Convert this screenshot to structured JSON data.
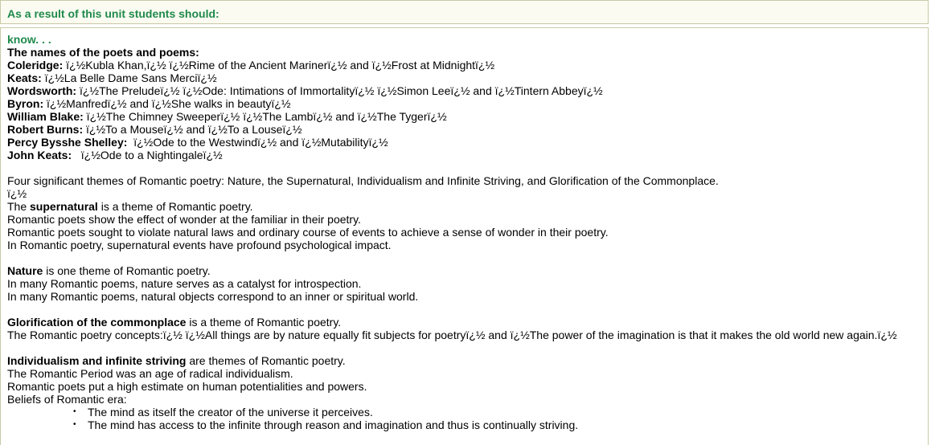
{
  "header": {
    "title": "As a result of this unit students should:"
  },
  "know_label": "know. . .",
  "names_heading": "The names of the poets and poems:",
  "poets": [
    {
      "name": "Coleridge:",
      "works": " ï¿½Kubla Khan,ï¿½ ï¿½Rime of the Ancient Marinerï¿½ and ï¿½Frost at Midnightï¿½"
    },
    {
      "name": "Keats:",
      "works": " ï¿½La Belle Dame Sans Merciï¿½"
    },
    {
      "name": "Wordsworth:",
      "works": " ï¿½The Preludeï¿½ ï¿½Ode: Intimations of Immortalityï¿½ ï¿½Simon Leeï¿½ and ï¿½Tintern Abbeyï¿½"
    },
    {
      "name": "Byron:",
      "works": " ï¿½Manfredï¿½ and ï¿½She walks in beautyï¿½"
    },
    {
      "name": "William Blake:",
      "works": " ï¿½The Chimney Sweeperï¿½ ï¿½The Lambï¿½ and ï¿½The Tygerï¿½"
    },
    {
      "name": "Robert Burns:",
      "works": " ï¿½To a Mouseï¿½ and ï¿½To a Louseï¿½"
    },
    {
      "name": "Percy Bysshe Shelley:",
      "works": "  ï¿½Ode to the Westwindï¿½ and ï¿½Mutabilityï¿½"
    },
    {
      "name": "John Keats:",
      "works": "   ï¿½Ode to a Nightingaleï¿½"
    }
  ],
  "themes_intro": "Four significant themes of Romantic poetry: Nature, the Supernatural, Individualism and Infinite Striving, and Glorification of the Commonplace.",
  "stray": "ï¿½",
  "supernatural": {
    "pre": "The ",
    "bold": "supernatural",
    "post": " is a theme of Romantic poetry.",
    "lines": [
      "Romantic poets show the effect of wonder at the familiar in their poetry.",
      "Romantic poets sought to violate natural laws and ordinary course of events to achieve a sense of wonder in their poetry.",
      "In Romantic poetry, supernatural events have profound psychological impact."
    ]
  },
  "nature": {
    "bold": "Nature",
    "post": " is one theme of Romantic poetry.",
    "lines": [
      "In many Romantic poems, nature serves as a catalyst for introspection.",
      "In many Romantic poems, natural objects correspond to an inner or spiritual world."
    ]
  },
  "commonplace": {
    "bold": "Glorification of the commonplace",
    "post": " is a theme of Romantic poetry.",
    "lines": [
      "The Romantic poetry concepts:ï¿½ ï¿½All things are by nature equally fit subjects for poetryï¿½ and ï¿½The power of the imagination is that it makes the old world new again.ï¿½"
    ]
  },
  "individualism": {
    "bold": "Individualism and infinite striving",
    "post": " are themes of Romantic poetry.",
    "lines": [
      "The Romantic Period was an age of radical individualism.",
      "Romantic poets put a high estimate on human potentialities and powers.",
      "Beliefs of Romantic era:"
    ],
    "beliefs": [
      "The mind as itself the creator of the universe it perceives.",
      "The mind has access to the infinite through reason and imagination and thus is continually striving."
    ]
  }
}
